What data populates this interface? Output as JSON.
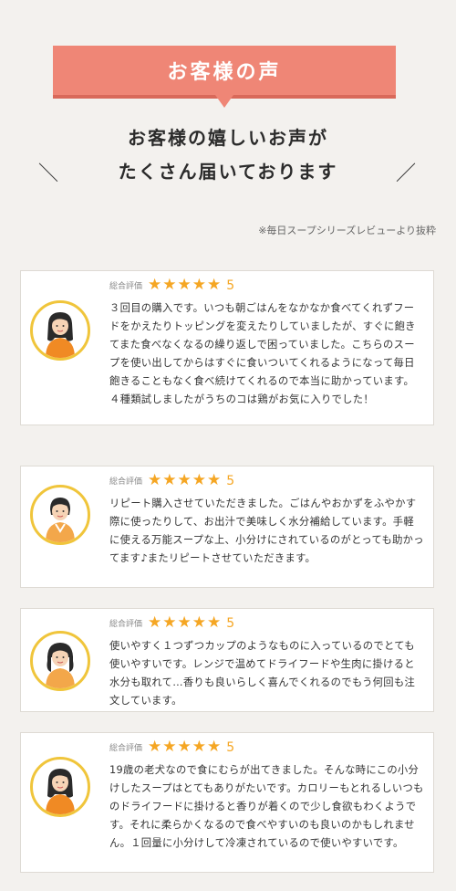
{
  "banner": {
    "title": "お客様の声"
  },
  "headline": {
    "line1": "お客様の嬉しいお声が",
    "line2": "たくさん届いております",
    "slash_left": "＼",
    "slash_right": "／"
  },
  "note": "※毎日スープシリーズレビューより抜粋",
  "colors": {
    "accent": "#ef8676",
    "star": "#f5a623",
    "avatar_ring": "#f0c53b"
  },
  "reviews": [
    {
      "rating_label": "総合評価",
      "stars": "★★★★★",
      "score": "5",
      "text": "３回目の購入です。いつも朝ごはんをなかなか食べてくれずフードをかえたりトッピングを変えたりしていましたが、すぐに飽きてまた食べなくなるの繰り返しで困っていました。こちらのスープを使い出してからはすぐに食いついてくれるようになって毎日飽きることもなく食べ続けてくれるので本当に助かっています。４種類試しましたがうちのコは鶏がお気に入りでした！"
    },
    {
      "rating_label": "総合評価",
      "stars": "★★★★★",
      "score": "5",
      "text": "リピート購入させていただきました。ごはんやおかずをふやかす際に使ったりして、お出汁で美味しく水分補給しています。手軽に使える万能スープな上、小分けにされているのがとっても助かってます♪またリピートさせていただきます。"
    },
    {
      "rating_label": "総合評価",
      "stars": "★★★★★",
      "score": "5",
      "text": "使いやすく１つずつカップのようなものに入っているのでとても使いやすいです。レンジで温めてドライフードや生肉に掛けると水分も取れて…香りも良いらしく喜んでくれるのでもう何回も注文しています。"
    },
    {
      "rating_label": "総合評価",
      "stars": "★★★★★",
      "score": "5",
      "text": "19歳の老犬なので食にむらが出てきました。そんな時にこの小分けしたスープはとてもありがたいです。カロリーもとれるしいつものドライフードに掛けると香りが着くので少し食欲もわくようです。それに柔らかくなるので食べやすいのも良いのかもしれません。１回量に小分けして冷凍されているので使いやすいです。"
    }
  ]
}
